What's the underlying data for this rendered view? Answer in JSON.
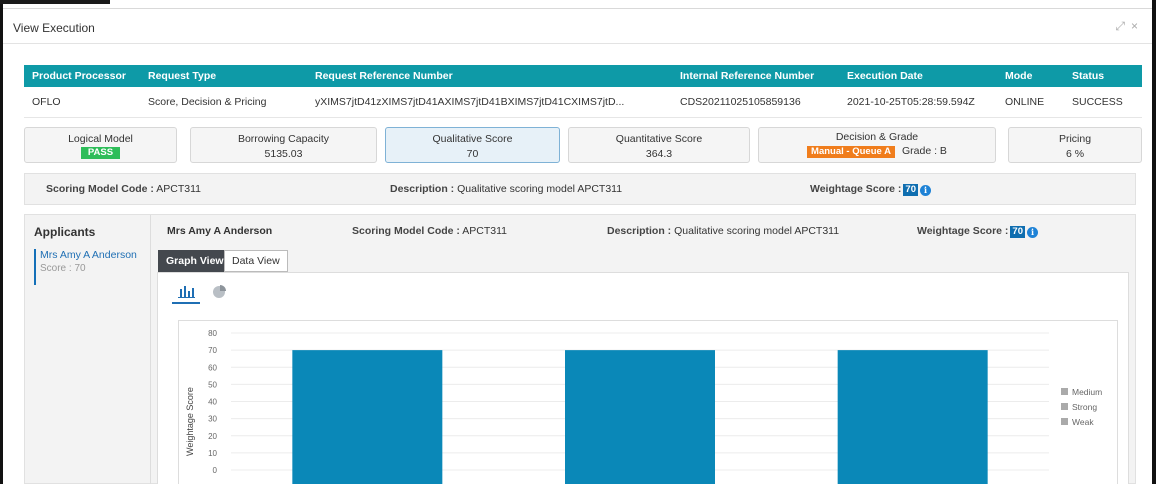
{
  "window": {
    "title": "View Execution",
    "controls": "↗↙ ×"
  },
  "table": {
    "headers": [
      "Product Processor",
      "Request Type",
      "Request Reference Number",
      "Internal Reference Number",
      "Execution Date",
      "Mode",
      "Status"
    ],
    "row": [
      "OFLO",
      "Score, Decision & Pricing",
      "yXIMS7jtD41zXIMS7jtD41AXIMS7jtD41BXIMS7jtD41CXIMS7jtD...",
      "CDS20211025105859136",
      "2021-10-25T05:28:59.594Z",
      "ONLINE",
      "SUCCESS"
    ]
  },
  "cards": {
    "logical": {
      "label": "Logical Model",
      "badge": "PASS"
    },
    "borrowing": {
      "label": "Borrowing Capacity",
      "value": "5135.03"
    },
    "qualitative": {
      "label": "Qualitative Score",
      "value": "70"
    },
    "quantitative": {
      "label": "Quantitative Score",
      "value": "364.3"
    },
    "decision": {
      "label": "Decision & Grade",
      "badge": "Manual - Queue A",
      "grade": "Grade : B"
    },
    "pricing": {
      "label": "Pricing",
      "value": "6 %"
    }
  },
  "summary": {
    "code_label": "Scoring Model Code :",
    "code_value": "APCT311",
    "desc_label": "Description :",
    "desc_value": "Qualitative scoring model APCT311",
    "weight_label": "Weightage Score :",
    "weight_value": "70",
    "info": "i"
  },
  "applicants": {
    "title": "Applicants",
    "items": [
      {
        "name": "Mrs Amy A Anderson",
        "score": "Score : 70"
      }
    ]
  },
  "detail": {
    "name": "Mrs Amy A Anderson",
    "code_label": "Scoring Model Code :",
    "code_value": "APCT311",
    "desc_label": "Description :",
    "desc_value": "Qualitative scoring model APCT311",
    "weight_label": "Weightage Score :",
    "weight_value": "70",
    "info": "i"
  },
  "tabs": {
    "graph": "Graph View",
    "data": "Data View"
  },
  "chart_data": {
    "type": "bar",
    "ylabel": "Weightage Score",
    "ylim": [
      0,
      80
    ],
    "yticks": [
      0,
      10,
      20,
      30,
      40,
      50,
      60,
      70,
      80
    ],
    "series": [
      {
        "name": "Medium",
        "values": [
          70,
          0,
          0
        ]
      },
      {
        "name": "Strong",
        "values": [
          0,
          70,
          0
        ]
      },
      {
        "name": "Weak",
        "values": [
          0,
          0,
          70
        ]
      }
    ],
    "bar_color": "#0a88b8",
    "legend": [
      "Medium",
      "Strong",
      "Weak"
    ],
    "legend_position": "right",
    "grid": true
  }
}
